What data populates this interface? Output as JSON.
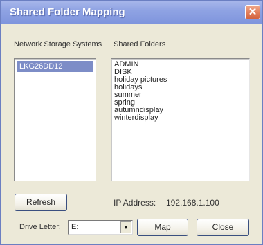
{
  "window": {
    "title": "Shared Folder Mapping",
    "close_symbol": "✕",
    "close_icon": "close-icon"
  },
  "colors": {
    "titlebar": "#8fa3e3",
    "close_button": "#e07a56",
    "selection": "#7d8dc7",
    "dialog_background": "#ece9d8"
  },
  "storage": {
    "label": "Network Storage Systems",
    "items": [
      "LKG26DD12"
    ],
    "selected": "LKG26DD12"
  },
  "folders": {
    "label": "Shared Folders",
    "items": [
      "ADMIN",
      "DISK",
      "holiday pictures",
      "holidays",
      "summer",
      "spring",
      "autumndisplay",
      "winterdisplay"
    ]
  },
  "refresh_button": {
    "label": "Refresh"
  },
  "ip": {
    "label": "IP Address:",
    "value": "192.168.1.100"
  },
  "drive": {
    "label": "Drive Letter:",
    "value": "E:",
    "arrow_symbol": "▼",
    "arrow_icon": "chevron-down-icon"
  },
  "map_button": {
    "label": "Map"
  },
  "close_button": {
    "label": "Close"
  }
}
